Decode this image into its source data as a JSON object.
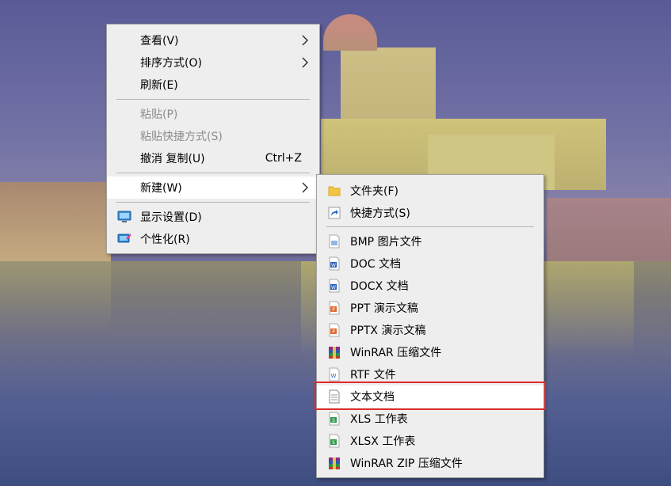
{
  "main_menu": {
    "view": "查看(V)",
    "sort": "排序方式(O)",
    "refresh": "刷新(E)",
    "paste": "粘贴(P)",
    "paste_shortcut": "粘贴快捷方式(S)",
    "undo": "撤消 复制(U)",
    "undo_shortcut": "Ctrl+Z",
    "new": "新建(W)",
    "display": "显示设置(D)",
    "personalize": "个性化(R)"
  },
  "sub_menu": {
    "folder": "文件夹(F)",
    "shortcut": "快捷方式(S)",
    "bmp": "BMP 图片文件",
    "doc": "DOC 文档",
    "docx": "DOCX 文档",
    "ppt": "PPT 演示文稿",
    "pptx": "PPTX 演示文稿",
    "winrar": "WinRAR 压缩文件",
    "rtf": "RTF 文件",
    "txt": "文本文档",
    "xls": "XLS 工作表",
    "xlsx": "XLSX 工作表",
    "winrar_zip": "WinRAR ZIP 压缩文件"
  },
  "colors": {
    "menu_bg": "#eeeeee",
    "highlight_bg": "#ffffff",
    "disabled_text": "#8d8d8d",
    "annotation_red": "#e02a2a",
    "word_blue": "#2b5fb8",
    "ppt_orange": "#e06a2e",
    "excel_green": "#2d9a4c"
  },
  "icons": {
    "folder": "folder-icon",
    "shortcut": "shortcut-arrow-icon",
    "bmp": "bmp-file-icon",
    "doc": "word-doc-icon",
    "docx": "word-docx-icon",
    "ppt": "ppt-file-icon",
    "pptx": "pptx-file-icon",
    "winrar": "winrar-archive-icon",
    "rtf": "rtf-file-icon",
    "txt": "text-file-icon",
    "xls": "xls-file-icon",
    "xlsx": "xlsx-file-icon",
    "winrar_zip": "winrar-zip-icon",
    "display": "display-settings-icon",
    "personalize": "personalize-icon"
  }
}
